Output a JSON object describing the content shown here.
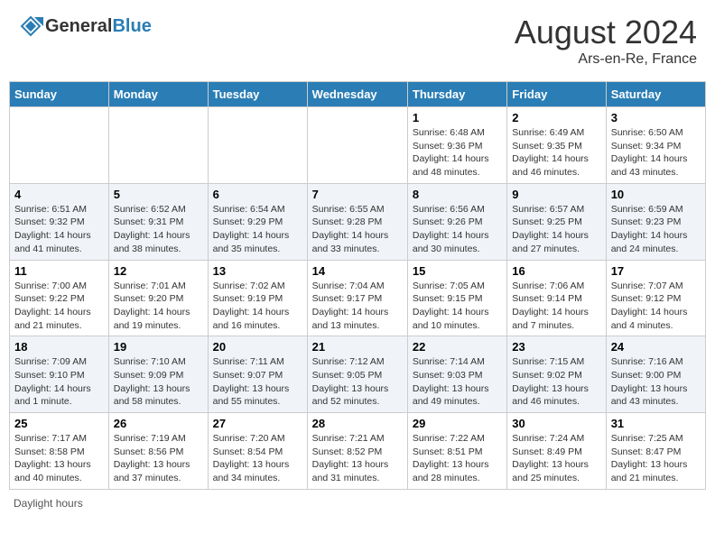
{
  "header": {
    "logo_general": "General",
    "logo_blue": "Blue",
    "month_title": "August 2024",
    "subtitle": "Ars-en-Re, France"
  },
  "days_of_week": [
    "Sunday",
    "Monday",
    "Tuesday",
    "Wednesday",
    "Thursday",
    "Friday",
    "Saturday"
  ],
  "weeks": [
    [
      {
        "num": "",
        "info": ""
      },
      {
        "num": "",
        "info": ""
      },
      {
        "num": "",
        "info": ""
      },
      {
        "num": "",
        "info": ""
      },
      {
        "num": "1",
        "info": "Sunrise: 6:48 AM\nSunset: 9:36 PM\nDaylight: 14 hours and 48 minutes."
      },
      {
        "num": "2",
        "info": "Sunrise: 6:49 AM\nSunset: 9:35 PM\nDaylight: 14 hours and 46 minutes."
      },
      {
        "num": "3",
        "info": "Sunrise: 6:50 AM\nSunset: 9:34 PM\nDaylight: 14 hours and 43 minutes."
      }
    ],
    [
      {
        "num": "4",
        "info": "Sunrise: 6:51 AM\nSunset: 9:32 PM\nDaylight: 14 hours and 41 minutes."
      },
      {
        "num": "5",
        "info": "Sunrise: 6:52 AM\nSunset: 9:31 PM\nDaylight: 14 hours and 38 minutes."
      },
      {
        "num": "6",
        "info": "Sunrise: 6:54 AM\nSunset: 9:29 PM\nDaylight: 14 hours and 35 minutes."
      },
      {
        "num": "7",
        "info": "Sunrise: 6:55 AM\nSunset: 9:28 PM\nDaylight: 14 hours and 33 minutes."
      },
      {
        "num": "8",
        "info": "Sunrise: 6:56 AM\nSunset: 9:26 PM\nDaylight: 14 hours and 30 minutes."
      },
      {
        "num": "9",
        "info": "Sunrise: 6:57 AM\nSunset: 9:25 PM\nDaylight: 14 hours and 27 minutes."
      },
      {
        "num": "10",
        "info": "Sunrise: 6:59 AM\nSunset: 9:23 PM\nDaylight: 14 hours and 24 minutes."
      }
    ],
    [
      {
        "num": "11",
        "info": "Sunrise: 7:00 AM\nSunset: 9:22 PM\nDaylight: 14 hours and 21 minutes."
      },
      {
        "num": "12",
        "info": "Sunrise: 7:01 AM\nSunset: 9:20 PM\nDaylight: 14 hours and 19 minutes."
      },
      {
        "num": "13",
        "info": "Sunrise: 7:02 AM\nSunset: 9:19 PM\nDaylight: 14 hours and 16 minutes."
      },
      {
        "num": "14",
        "info": "Sunrise: 7:04 AM\nSunset: 9:17 PM\nDaylight: 14 hours and 13 minutes."
      },
      {
        "num": "15",
        "info": "Sunrise: 7:05 AM\nSunset: 9:15 PM\nDaylight: 14 hours and 10 minutes."
      },
      {
        "num": "16",
        "info": "Sunrise: 7:06 AM\nSunset: 9:14 PM\nDaylight: 14 hours and 7 minutes."
      },
      {
        "num": "17",
        "info": "Sunrise: 7:07 AM\nSunset: 9:12 PM\nDaylight: 14 hours and 4 minutes."
      }
    ],
    [
      {
        "num": "18",
        "info": "Sunrise: 7:09 AM\nSunset: 9:10 PM\nDaylight: 14 hours and 1 minute."
      },
      {
        "num": "19",
        "info": "Sunrise: 7:10 AM\nSunset: 9:09 PM\nDaylight: 13 hours and 58 minutes."
      },
      {
        "num": "20",
        "info": "Sunrise: 7:11 AM\nSunset: 9:07 PM\nDaylight: 13 hours and 55 minutes."
      },
      {
        "num": "21",
        "info": "Sunrise: 7:12 AM\nSunset: 9:05 PM\nDaylight: 13 hours and 52 minutes."
      },
      {
        "num": "22",
        "info": "Sunrise: 7:14 AM\nSunset: 9:03 PM\nDaylight: 13 hours and 49 minutes."
      },
      {
        "num": "23",
        "info": "Sunrise: 7:15 AM\nSunset: 9:02 PM\nDaylight: 13 hours and 46 minutes."
      },
      {
        "num": "24",
        "info": "Sunrise: 7:16 AM\nSunset: 9:00 PM\nDaylight: 13 hours and 43 minutes."
      }
    ],
    [
      {
        "num": "25",
        "info": "Sunrise: 7:17 AM\nSunset: 8:58 PM\nDaylight: 13 hours and 40 minutes."
      },
      {
        "num": "26",
        "info": "Sunrise: 7:19 AM\nSunset: 8:56 PM\nDaylight: 13 hours and 37 minutes."
      },
      {
        "num": "27",
        "info": "Sunrise: 7:20 AM\nSunset: 8:54 PM\nDaylight: 13 hours and 34 minutes."
      },
      {
        "num": "28",
        "info": "Sunrise: 7:21 AM\nSunset: 8:52 PM\nDaylight: 13 hours and 31 minutes."
      },
      {
        "num": "29",
        "info": "Sunrise: 7:22 AM\nSunset: 8:51 PM\nDaylight: 13 hours and 28 minutes."
      },
      {
        "num": "30",
        "info": "Sunrise: 7:24 AM\nSunset: 8:49 PM\nDaylight: 13 hours and 25 minutes."
      },
      {
        "num": "31",
        "info": "Sunrise: 7:25 AM\nSunset: 8:47 PM\nDaylight: 13 hours and 21 minutes."
      }
    ]
  ],
  "footer": {
    "label": "Daylight hours"
  }
}
